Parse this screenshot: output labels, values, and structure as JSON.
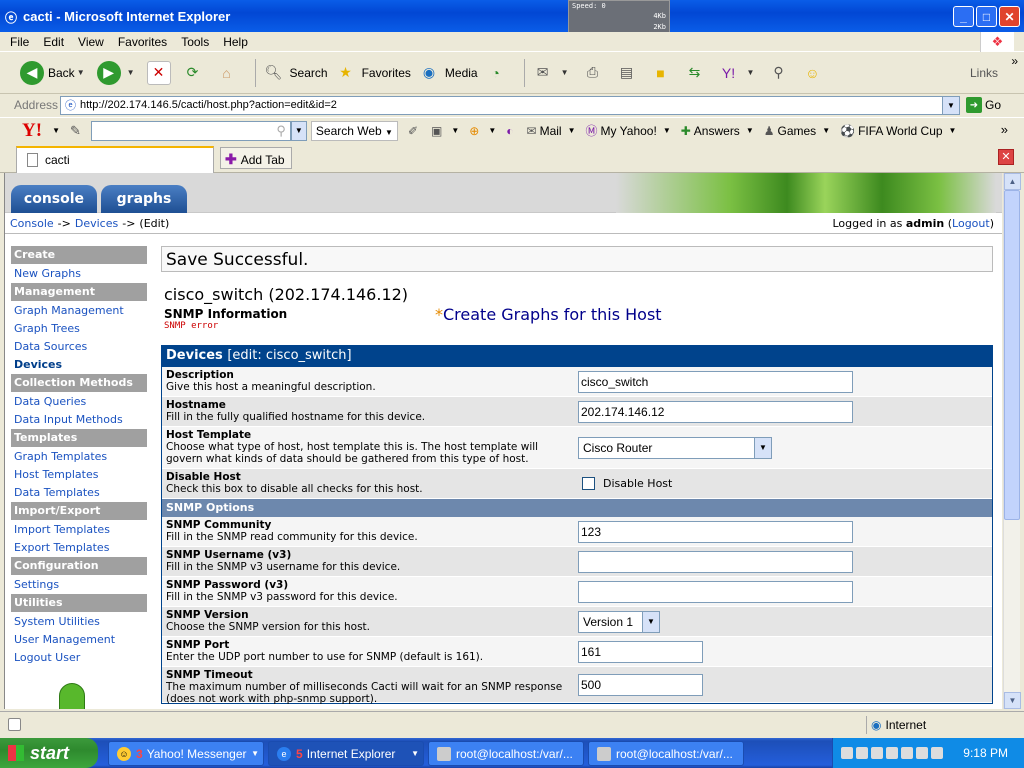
{
  "window": {
    "title": "cacti - Microsoft Internet Explorer",
    "speed_label": "Speed:",
    "speed_value": "0",
    "speed_rate1": "4Kb",
    "speed_rate2": "2Kb"
  },
  "menubar": {
    "items": [
      "File",
      "Edit",
      "View",
      "Favorites",
      "Tools",
      "Help"
    ]
  },
  "toolbar": {
    "back": "Back",
    "search": "Search",
    "favorites": "Favorites",
    "media": "Media",
    "links": "Links"
  },
  "address": {
    "label": "Address",
    "url": "http://202.174.146.5/cacti/host.php?action=edit&id=2",
    "go": "Go"
  },
  "yahoo": {
    "search_web": "Search Web",
    "mail": "Mail",
    "my_yahoo": "My Yahoo!",
    "answers": "Answers",
    "games": "Games",
    "fifa": "FIFA World Cup"
  },
  "tabs": {
    "current": "cacti",
    "add_tab": "Add Tab"
  },
  "cacti": {
    "tabs": [
      "console",
      "graphs"
    ],
    "breadcrumb": [
      "Console",
      "Devices",
      "(Edit)"
    ],
    "login_prefix": "Logged in as",
    "login_user": "admin",
    "logout": "Logout",
    "menu": [
      {
        "type": "head",
        "label": "Create"
      },
      {
        "type": "link",
        "label": "New Graphs"
      },
      {
        "type": "head",
        "label": "Management"
      },
      {
        "type": "link",
        "label": "Graph Management"
      },
      {
        "type": "link",
        "label": "Graph Trees"
      },
      {
        "type": "link",
        "label": "Data Sources"
      },
      {
        "type": "link",
        "label": "Devices",
        "active": true
      },
      {
        "type": "head",
        "label": "Collection Methods"
      },
      {
        "type": "link",
        "label": "Data Queries"
      },
      {
        "type": "link",
        "label": "Data Input Methods"
      },
      {
        "type": "head",
        "label": "Templates"
      },
      {
        "type": "link",
        "label": "Graph Templates"
      },
      {
        "type": "link",
        "label": "Host Templates"
      },
      {
        "type": "link",
        "label": "Data Templates"
      },
      {
        "type": "head",
        "label": "Import/Export"
      },
      {
        "type": "link",
        "label": "Import Templates"
      },
      {
        "type": "link",
        "label": "Export Templates"
      },
      {
        "type": "head",
        "label": "Configuration"
      },
      {
        "type": "link",
        "label": "Settings"
      },
      {
        "type": "head",
        "label": "Utilities"
      },
      {
        "type": "link",
        "label": "System Utilities"
      },
      {
        "type": "link",
        "label": "User Management"
      },
      {
        "type": "link",
        "label": "Logout User"
      }
    ],
    "save_message": "Save Successful.",
    "host_title": "cisco_switch (202.174.146.12)",
    "snmp_info_label": "SNMP Information",
    "snmp_error": "SNMP error",
    "create_graphs": "Create Graphs for this Host",
    "devices_header": "Devices",
    "devices_header_sub": "[edit: cisco_switch]",
    "snmp_options": "SNMP Options",
    "fields": {
      "description": {
        "title": "Description",
        "help": "Give this host a meaningful description.",
        "value": "cisco_switch"
      },
      "hostname": {
        "title": "Hostname",
        "help": "Fill in the fully qualified hostname for this device.",
        "value": "202.174.146.12"
      },
      "host_template": {
        "title": "Host Template",
        "help": "Choose what type of host, host template this is. The host template will govern what kinds of data should be gathered from this type of host.",
        "value": "Cisco Router"
      },
      "disable_host": {
        "title": "Disable Host",
        "help": "Check this box to disable all checks for this host.",
        "label": "Disable Host"
      },
      "snmp_community": {
        "title": "SNMP Community",
        "help": "Fill in the SNMP read community for this device.",
        "value": "123"
      },
      "snmp_username": {
        "title": "SNMP Username (v3)",
        "help": "Fill in the SNMP v3 username for this device.",
        "value": ""
      },
      "snmp_password": {
        "title": "SNMP Password (v3)",
        "help": "Fill in the SNMP v3 password for this device.",
        "value": ""
      },
      "snmp_version": {
        "title": "SNMP Version",
        "help": "Choose the SNMP version for this host.",
        "value": "Version 1"
      },
      "snmp_port": {
        "title": "SNMP Port",
        "help": "Enter the UDP port number to use for SNMP (default is 161).",
        "value": "161"
      },
      "snmp_timeout": {
        "title": "SNMP Timeout",
        "help": "The maximum number of milliseconds Cacti will wait for an SNMP response (does not work with php-snmp support).",
        "value": "500"
      }
    }
  },
  "statusbar": {
    "zone": "Internet"
  },
  "taskbar": {
    "start": "start",
    "buttons": [
      {
        "label": "Yahoo! Messenger",
        "count": "3"
      },
      {
        "label": "Internet Explorer",
        "count": "5"
      },
      {
        "label": "root@localhost:/var/..."
      },
      {
        "label": "root@localhost:/var/..."
      }
    ],
    "clock": "9:18 PM"
  }
}
